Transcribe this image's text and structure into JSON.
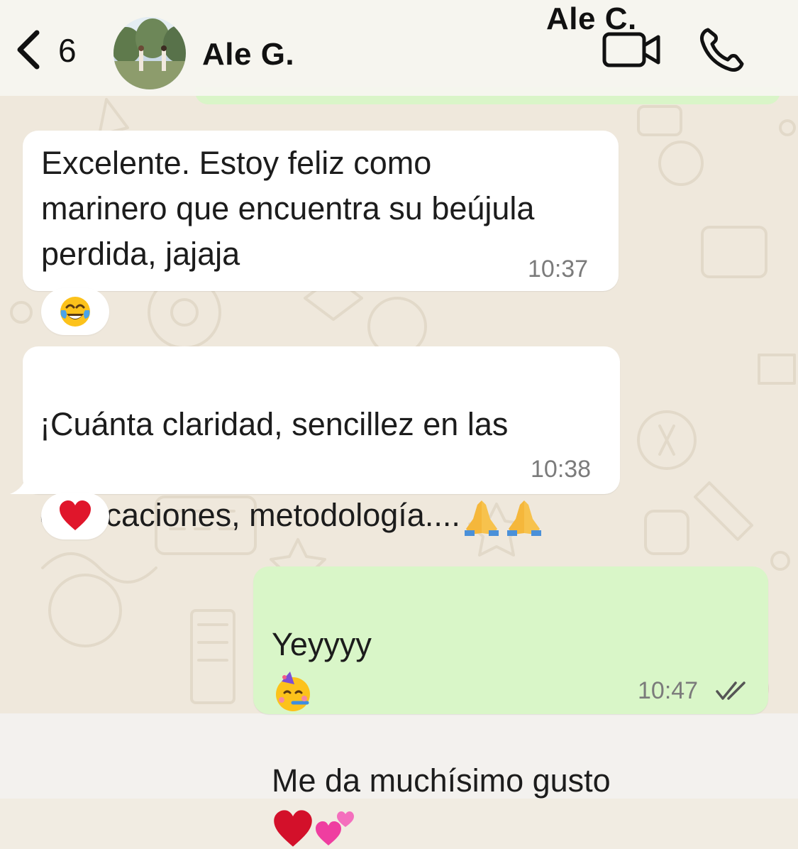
{
  "header": {
    "back_count": "6",
    "contact_name": "Ale G.",
    "overlay_name": "Ale C."
  },
  "messages": [
    {
      "direction": "incoming",
      "text": "Excelente. Estoy feliz como\nmarinero que encuentra su beújula\nperdida, jajaja",
      "time": "10:37",
      "reaction": "face-with-tears-of-joy-icon"
    },
    {
      "direction": "incoming",
      "line1": "¡Cuánta claridad,  sencillez en las",
      "line2": "explicaciones, metodología....",
      "emojis": [
        "folded-hands-icon",
        "folded-hands-icon"
      ],
      "time": "10:38",
      "reaction": "red-heart-icon"
    },
    {
      "direction": "outgoing",
      "line1": "Yeyyyy",
      "line1_emoji": "partying-face-icon",
      "line2": "Me da muchísimo gusto",
      "line2_emojis": [
        "red-heart-icon",
        "two-hearts-icon"
      ],
      "time": "10:47",
      "status": "read-double-check"
    }
  ],
  "colors": {
    "outgoing_bubble": "#d9f6c8",
    "incoming_bubble": "#ffffff",
    "wallpaper": "#efe8dc",
    "read_check": "#555555"
  }
}
